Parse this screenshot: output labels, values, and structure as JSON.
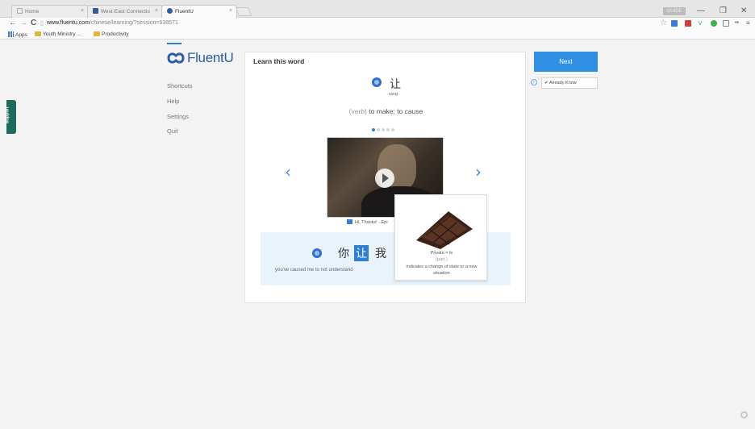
{
  "browser": {
    "tabs": [
      {
        "title": "Home"
      },
      {
        "title": "West-East Connectio"
      },
      {
        "title": "FluentU"
      }
    ],
    "url_host": "www.fluentu.com",
    "url_path": "/chinese/learning/?session=538571",
    "user_label": "GUIDE",
    "bookmarks": [
      "Apps",
      "Youth Ministry ...",
      "Productivity"
    ]
  },
  "support": {
    "label": "Support"
  },
  "app": {
    "logo": "FluentU",
    "menu": [
      "Shortcuts",
      "Help",
      "Settings",
      "Quit"
    ]
  },
  "card": {
    "title": "Learn this word",
    "word": "让",
    "pinyin": "ràng",
    "pos": "(verb)",
    "definition": "to make; to cause",
    "dots_total": 5,
    "dots_active": 1,
    "video_caption": "Hi, Thanks! - Epi"
  },
  "sentence": {
    "chars": [
      "你",
      "让",
      "我"
    ],
    "highlight_index": 1,
    "translation": "you've caused me to not understand"
  },
  "popup": {
    "term": "Private = le",
    "pinyin": "(part.)",
    "description": "indicates a change of state or a new situation"
  },
  "actions": {
    "next": "Next",
    "already_know": "Already Know"
  },
  "colors": {
    "accent": "#2f8fe3",
    "brand": "#2b5f9e",
    "support": "#1e6b5e",
    "highlight_bg": "#e8f3fc"
  },
  "icons": [
    "speaker-icon",
    "play-icon",
    "chevron-left-icon",
    "chevron-right-icon",
    "check-icon",
    "info-icon"
  ]
}
